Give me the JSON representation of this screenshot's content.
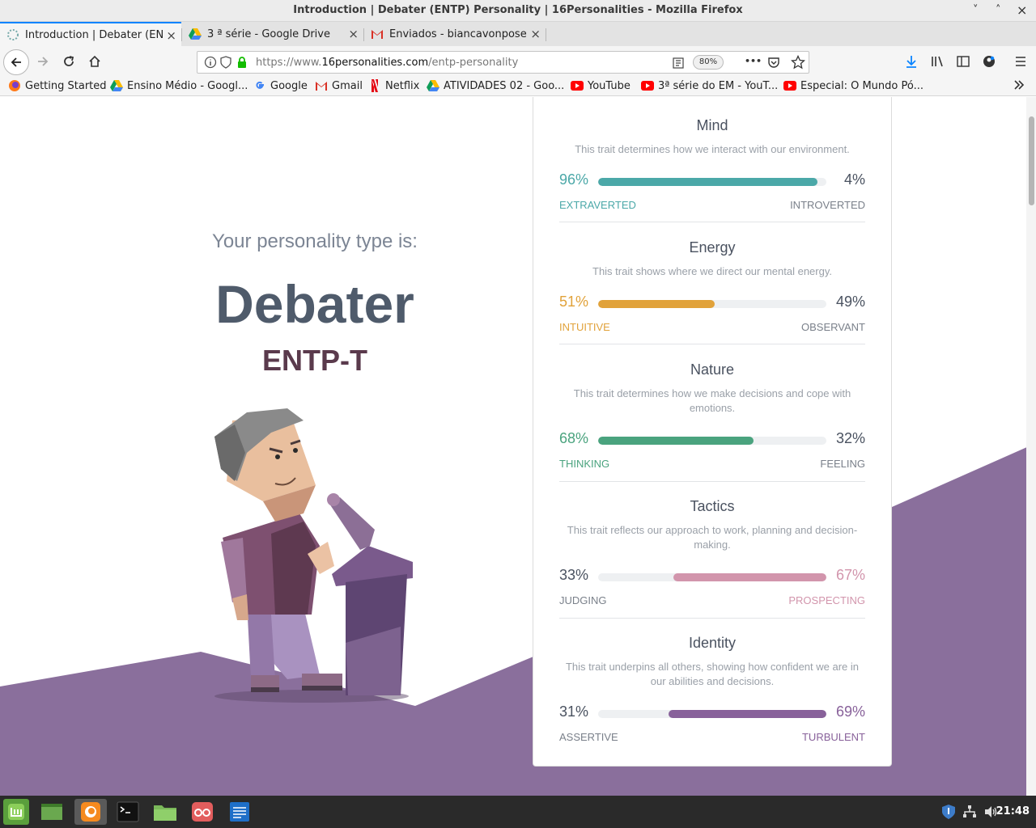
{
  "window": {
    "title": "Introduction | Debater (ENTP) Personality | 16Personalities - Mozilla Firefox",
    "minimize": "˅",
    "maximize": "˄",
    "close": "×"
  },
  "tabs": [
    {
      "label": "Introduction | Debater (ENTP",
      "close": "×",
      "icon": "16personalities-icon",
      "active": true
    },
    {
      "label": "3 ª série - Google Drive",
      "close": "×",
      "icon": "google-drive-icon",
      "active": false
    },
    {
      "label": "Enviados - biancavonposer",
      "close": "×",
      "icon": "gmail-icon",
      "active": false
    }
  ],
  "newtab": "+",
  "nav": {
    "url_prefix": "https://www.",
    "url_domain": "16personalities.com",
    "url_path": "/entp-personality",
    "zoom": "80%",
    "more": "•••"
  },
  "bookmarks": [
    {
      "label": "Getting Started",
      "icon": "firefox-icon"
    },
    {
      "label": "Ensino Médio - Googl...",
      "icon": "google-drive-icon"
    },
    {
      "label": "Google",
      "icon": "google-icon"
    },
    {
      "label": "Gmail",
      "icon": "gmail-icon"
    },
    {
      "label": "Netflix",
      "icon": "netflix-icon"
    },
    {
      "label": "ATIVIDADES 02 - Goo...",
      "icon": "google-drive-icon"
    },
    {
      "label": "YouTube",
      "icon": "youtube-icon"
    },
    {
      "label": "3ª série do EM - YouT...",
      "icon": "youtube-icon"
    },
    {
      "label": "Especial: O Mundo Pó...",
      "icon": "youtube-icon"
    }
  ],
  "hero": {
    "intro": "Your personality type is:",
    "type_name": "Debater",
    "type_code": "ENTP-T"
  },
  "traits": [
    {
      "title": "Mind",
      "desc": "This trait determines how we interact with our environment.",
      "left_pct": "96%",
      "right_pct": "4%",
      "left_label": "EXTRAVERTED",
      "right_label": "INTROVERTED",
      "value": 0.96,
      "dominant": "left",
      "color": "#4ba8a8"
    },
    {
      "title": "Energy",
      "desc": "This trait shows where we direct our mental energy.",
      "left_pct": "51%",
      "right_pct": "49%",
      "left_label": "INTUITIVE",
      "right_label": "OBSERVANT",
      "value": 0.51,
      "dominant": "left",
      "color": "#e1a23a"
    },
    {
      "title": "Nature",
      "desc": "This trait determines how we make decisions and cope with emotions.",
      "left_pct": "68%",
      "right_pct": "32%",
      "left_label": "THINKING",
      "right_label": "FEELING",
      "value": 0.68,
      "dominant": "left",
      "color": "#4aa37e"
    },
    {
      "title": "Tactics",
      "desc": "This trait reflects our approach to work, planning and decision-making.",
      "left_pct": "33%",
      "right_pct": "67%",
      "left_label": "JUDGING",
      "right_label": "PROSPECTING",
      "value": 0.67,
      "dominant": "right",
      "color": "#d295ac"
    },
    {
      "title": "Identity",
      "desc": "This trait underpins all others, showing how confident we are in our abilities and decisions.",
      "left_pct": "31%",
      "right_pct": "69%",
      "left_label": "ASSERTIVE",
      "right_label": "TURBULENT",
      "value": 0.69,
      "dominant": "right",
      "color": "#88619a"
    }
  ],
  "colors": {
    "neutral_text": "#4a5260",
    "neutral_label": "#7a808a",
    "background_purple": "#8a6f9c"
  },
  "taskbar": {
    "clock": "21:48",
    "apps": [
      "mint-menu-icon",
      "show-desktop-icon",
      "firefox-icon",
      "terminal-icon",
      "files-icon",
      "glasses-app-icon",
      "text-editor-icon"
    ]
  }
}
